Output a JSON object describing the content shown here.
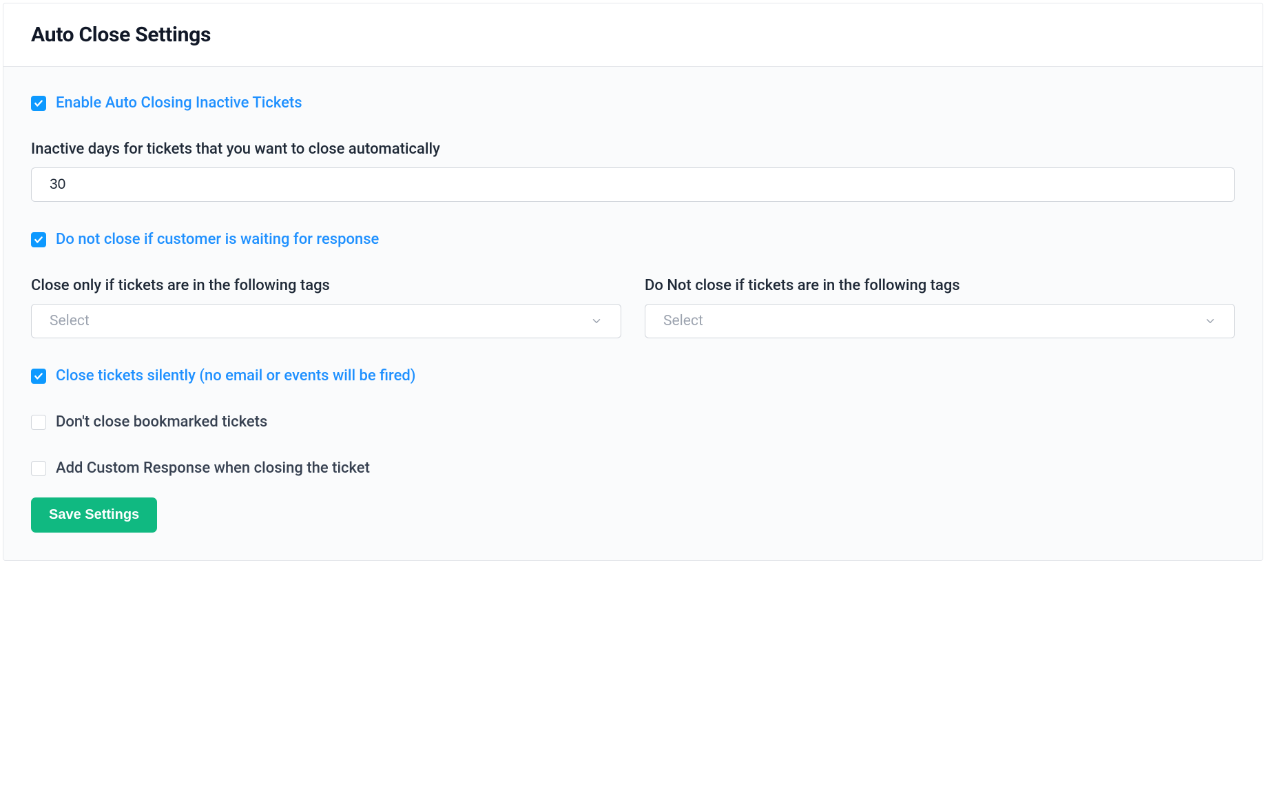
{
  "header": {
    "title": "Auto Close Settings"
  },
  "checkboxes": {
    "enable": {
      "label": "Enable Auto Closing Inactive Tickets",
      "checked": true
    },
    "waiting": {
      "label": "Do not close if customer is waiting for response",
      "checked": true
    },
    "silent": {
      "label": "Close tickets silently (no email or events will be fired)",
      "checked": true
    },
    "bookmarked": {
      "label": "Don't close bookmarked tickets",
      "checked": false
    },
    "custom_response": {
      "label": "Add Custom Response when closing the ticket",
      "checked": false
    }
  },
  "fields": {
    "inactive_days": {
      "label": "Inactive days for tickets that you want to close automatically",
      "value": "30"
    },
    "close_tags": {
      "label": "Close only if tickets are in the following tags",
      "placeholder": "Select"
    },
    "exclude_tags": {
      "label": "Do Not close if tickets are in the following tags",
      "placeholder": "Select"
    }
  },
  "buttons": {
    "save": "Save Settings"
  }
}
